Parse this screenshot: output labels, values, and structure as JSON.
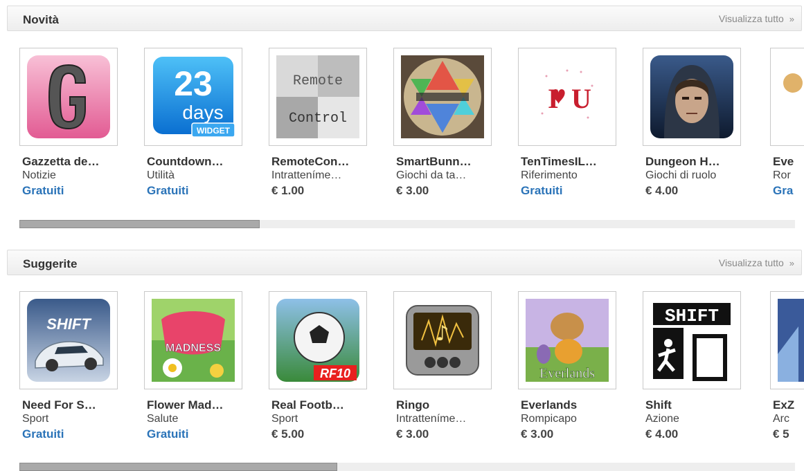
{
  "sections": [
    {
      "title": "Novità",
      "view_all": "Visualizza tutto",
      "view_all_chevron": "»",
      "apps": [
        {
          "name": "Gazzetta de…",
          "category": "Notizie",
          "price": "Gratuiti",
          "icon": "gazzetta-g-icon"
        },
        {
          "name": "Countdown…",
          "category": "Utilità",
          "price": "Gratuiti",
          "icon": "countdown-23-days-widget-icon",
          "icon_text": {
            "num": "23",
            "unit": "days",
            "badge": "WIDGET"
          }
        },
        {
          "name": "RemoteCon…",
          "category": "Intratteníme…",
          "price": "€ 1.00",
          "icon": "remote-control-icon",
          "icon_text": {
            "line1": "Remote",
            "line2": "Control"
          }
        },
        {
          "name": "SmartBunn…",
          "category": "Giochi da ta…",
          "price": "€ 3.00",
          "icon": "chinese-checkers-board-icon"
        },
        {
          "name": "TenTimesIL…",
          "category": "Riferimento",
          "price": "Gratuiti",
          "icon": "i-love-u-icon",
          "icon_text": {
            "a": "I",
            "b": "U"
          }
        },
        {
          "name": "Dungeon H…",
          "category": "Giochi di ruolo",
          "price": "€ 4.00",
          "icon": "dungeon-hero-face-icon"
        },
        {
          "name": "Eve",
          "category": "Ror",
          "price": "Gra",
          "icon": "partial-app-icon"
        }
      ],
      "scroll_fraction": 0.31
    },
    {
      "title": "Suggerite",
      "view_all": "Visualizza tutto",
      "view_all_chevron": "»",
      "apps": [
        {
          "name": "Need For S…",
          "category": "Sport",
          "price": "Gratuiti",
          "icon": "need-for-speed-shift-car-icon",
          "icon_text": {
            "t": "SHIFT"
          }
        },
        {
          "name": "Flower Mad…",
          "category": "Salute",
          "price": "Gratuiti",
          "icon": "flower-madness-icon",
          "icon_text": {
            "t": "MADNESS"
          }
        },
        {
          "name": "Real Footb…",
          "category": "Sport",
          "price": "€ 5.00",
          "icon": "real-football-ball-icon",
          "icon_text": {
            "t": "RF10"
          }
        },
        {
          "name": "Ringo",
          "category": "Intratteníme…",
          "price": "€ 3.00",
          "icon": "ringo-music-player-icon"
        },
        {
          "name": "Everlands",
          "category": "Rompicapo",
          "price": "€ 3.00",
          "icon": "everlands-animals-icon",
          "icon_text": {
            "t": "Everlands"
          }
        },
        {
          "name": "Shift",
          "category": "Azione",
          "price": "€ 4.00",
          "icon": "shift-door-runner-icon",
          "icon_text": {
            "t": "SHIFT"
          }
        },
        {
          "name": "ExZ",
          "category": "Arc",
          "price": "€ 5",
          "icon": "partial-app-icon"
        }
      ],
      "scroll_fraction": 0.41
    }
  ],
  "colors": {
    "free_price": "#2a73b8",
    "text": "#333333",
    "muted": "#888888"
  }
}
